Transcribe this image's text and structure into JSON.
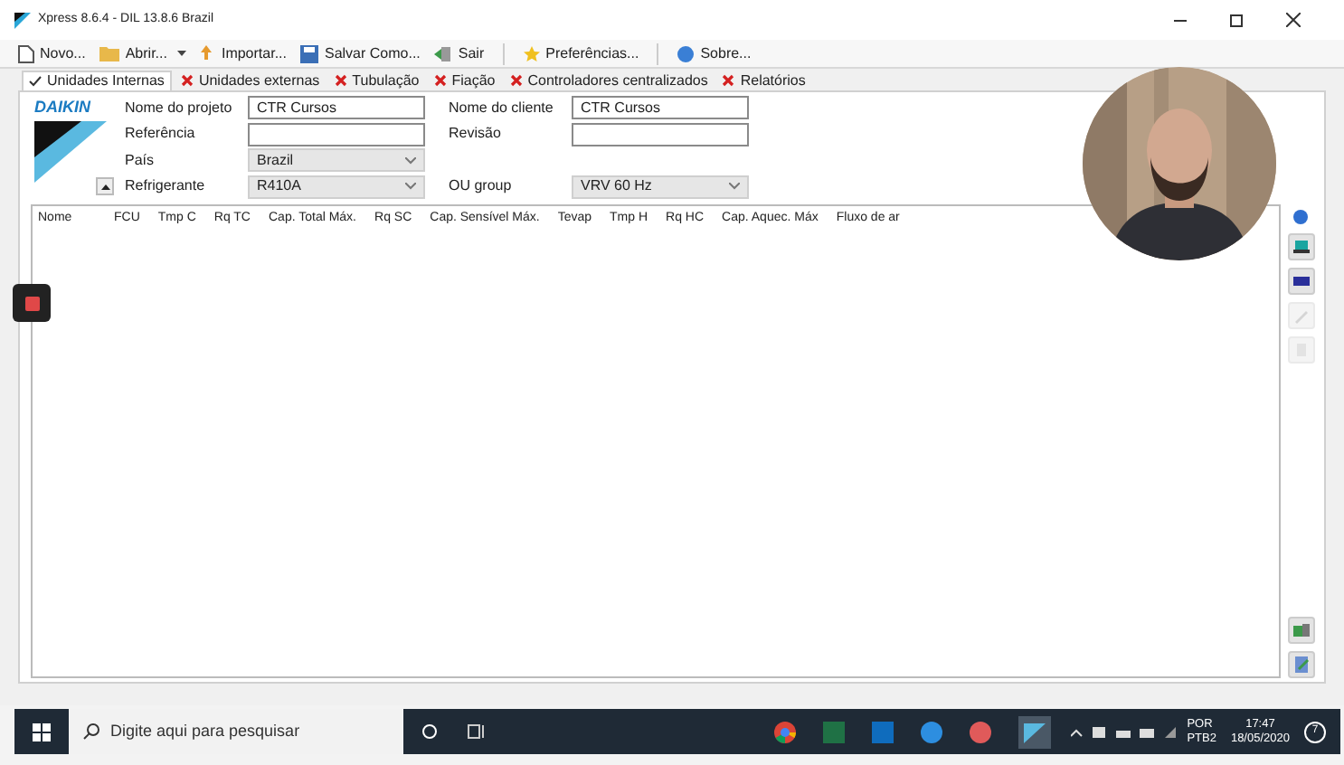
{
  "window": {
    "title": "Xpress 8.6.4 - DIL 13.8.6 Brazil"
  },
  "toolbar": [
    {
      "label": "Novo..."
    },
    {
      "label": "Abrir..."
    },
    {
      "label": "Importar..."
    },
    {
      "label": "Salvar Como..."
    },
    {
      "label": "Sair"
    },
    {
      "label": "Preferências..."
    },
    {
      "label": "Sobre..."
    }
  ],
  "tabs": [
    {
      "label": "Unidades Internas",
      "selected": true,
      "valid": true
    },
    {
      "label": "Unidades externas",
      "selected": false,
      "valid": false
    },
    {
      "label": "Tubulação",
      "selected": false,
      "valid": false
    },
    {
      "label": "Fiação",
      "selected": false,
      "valid": false
    },
    {
      "label": "Controladores centralizados",
      "selected": false,
      "valid": false
    },
    {
      "label": "Relatórios",
      "selected": false,
      "valid": false
    }
  ],
  "logo": "DAIKIN",
  "form": {
    "left": [
      {
        "label": "Nome do projeto",
        "kind": "text",
        "value": "CTR Cursos"
      },
      {
        "label": "Referência",
        "kind": "text"
      },
      {
        "label": "País",
        "kind": "select",
        "value": "Brazil"
      },
      {
        "label": "Refrigerante",
        "kind": "select",
        "value": "R410A"
      }
    ],
    "right": [
      {
        "label": "Nome do cliente",
        "kind": "text",
        "value": "CTR Cursos"
      },
      {
        "label": "Revisão",
        "kind": "text"
      },
      {
        "label": "OU group",
        "kind": "select",
        "value": "VRV 60 Hz"
      }
    ]
  },
  "table": {
    "columns": [
      "Nome",
      "FCU",
      "Tmp C",
      "Rq TC",
      "Cap. Total Máx.",
      "Rq SC",
      "Cap. Sensível Máx.",
      "Tevap",
      "Tmp H",
      "Rq HC",
      "Cap. Aquec. Máx",
      "Fluxo de ar"
    ]
  },
  "side_buttons": [
    {
      "disabled": false
    },
    {
      "disabled": false
    },
    {
      "disabled": true
    },
    {
      "disabled": true
    }
  ],
  "taskbar": {
    "search_placeholder": "Digite aqui para pesquisar",
    "language": "POR",
    "layout": "PTB2",
    "time": "17:47",
    "date": "18/05/2020",
    "notifications": "7"
  }
}
